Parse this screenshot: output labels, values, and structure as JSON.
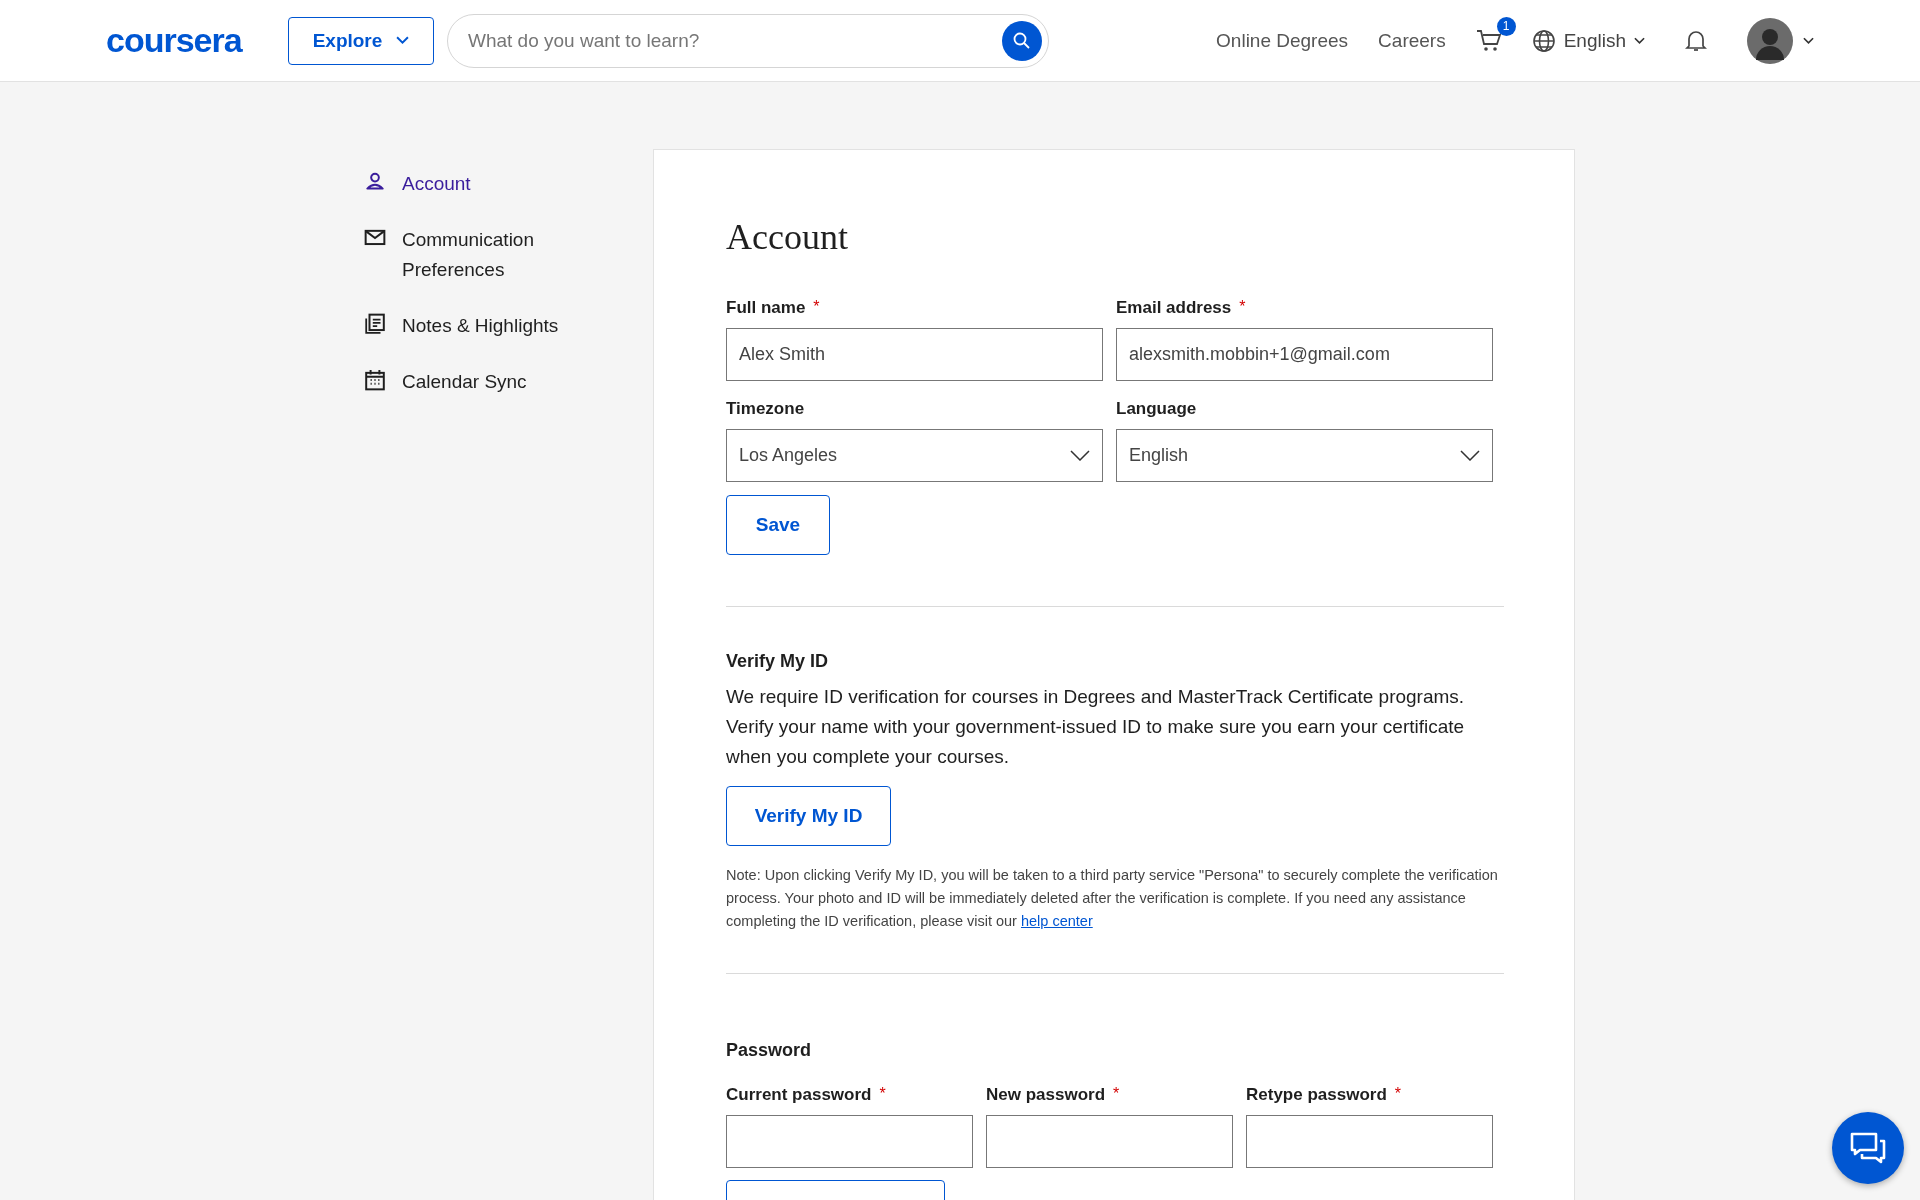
{
  "header": {
    "logo": "coursera",
    "explore": "Explore",
    "search": {
      "placeholder": "What do you want to learn?"
    },
    "nav_links": [
      "Online Degrees",
      "Careers"
    ],
    "cart_badge": "1",
    "language": "English"
  },
  "sidebar": {
    "items": [
      {
        "label": "Account",
        "kind": "person",
        "selected": true
      },
      {
        "label": "Communication Preferences",
        "kind": "mail",
        "selected": false
      },
      {
        "label": "Notes & Highlights",
        "kind": "notes",
        "selected": false
      },
      {
        "label": "Calendar Sync",
        "kind": "calendar",
        "selected": false
      }
    ]
  },
  "account": {
    "title": "Account",
    "fields": [
      {
        "label": "Full name",
        "required_mark": "*",
        "kind": "text",
        "value": "Alex Smith"
      },
      {
        "label": "Email address",
        "required_mark": "*",
        "kind": "text",
        "value": "alexsmith.mobbin+1@gmail.com"
      },
      {
        "label": "Timezone",
        "kind": "select",
        "value": "Los Angeles"
      },
      {
        "label": "Language",
        "kind": "select",
        "value": "English"
      }
    ],
    "save": "Save"
  },
  "verify": {
    "title": "Verify My ID",
    "text": "We require ID verification for courses in Degrees and MasterTrack Certificate programs. Verify your name with your government-issued ID to make sure you earn your certificate when you complete your courses.",
    "button": "Verify My ID",
    "note": "Note: Upon clicking Verify My ID, you will be taken to a third party service \"Persona\" to securely complete the verification process. Your photo and ID will be immediately deleted after the verification is complete. If you need any assistance completing the ID verification, please visit our",
    "link": "help center"
  },
  "password": {
    "title": "Password",
    "fields": [
      {
        "label": "Current password",
        "required_mark": "*"
      },
      {
        "label": "New password",
        "required_mark": "*"
      },
      {
        "label": "Retype password",
        "required_mark": "*"
      }
    ]
  }
}
